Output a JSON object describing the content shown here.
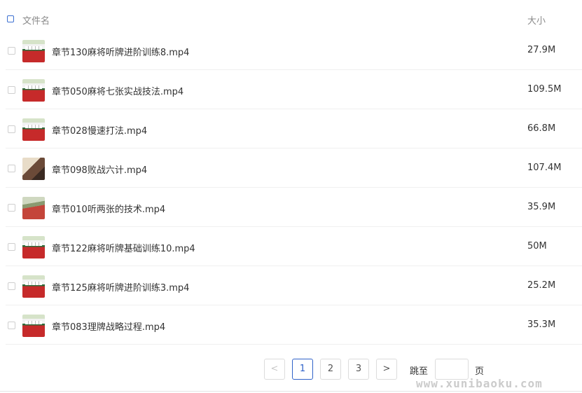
{
  "header": {
    "name_label": "文件名",
    "size_label": "大小"
  },
  "files": [
    {
      "name": "章节130麻将听牌进阶训练8.mp4",
      "size": "27.9M",
      "thumb": "red"
    },
    {
      "name": "章节050麻将七张实战技法.mp4",
      "size": "109.5M",
      "thumb": "red"
    },
    {
      "name": "章节028慢速打法.mp4",
      "size": "66.8M",
      "thumb": "red"
    },
    {
      "name": "章节098败战六计.mp4",
      "size": "107.4M",
      "thumb": "person"
    },
    {
      "name": "章节010听两张的技术.mp4",
      "size": "35.9M",
      "thumb": "table"
    },
    {
      "name": "章节122麻将听牌基础训练10.mp4",
      "size": "50M",
      "thumb": "red"
    },
    {
      "name": "章节125麻将听牌进阶训练3.mp4",
      "size": "25.2M",
      "thumb": "red"
    },
    {
      "name": "章节083理牌战略过程.mp4",
      "size": "35.3M",
      "thumb": "red"
    }
  ],
  "pagination": {
    "prev": "<",
    "pages": [
      "1",
      "2",
      "3"
    ],
    "current": "1",
    "next": ">",
    "jump_label": "跳至",
    "page_suffix": "页",
    "jump_value": ""
  },
  "watermark": "www.xunibaoku.com"
}
